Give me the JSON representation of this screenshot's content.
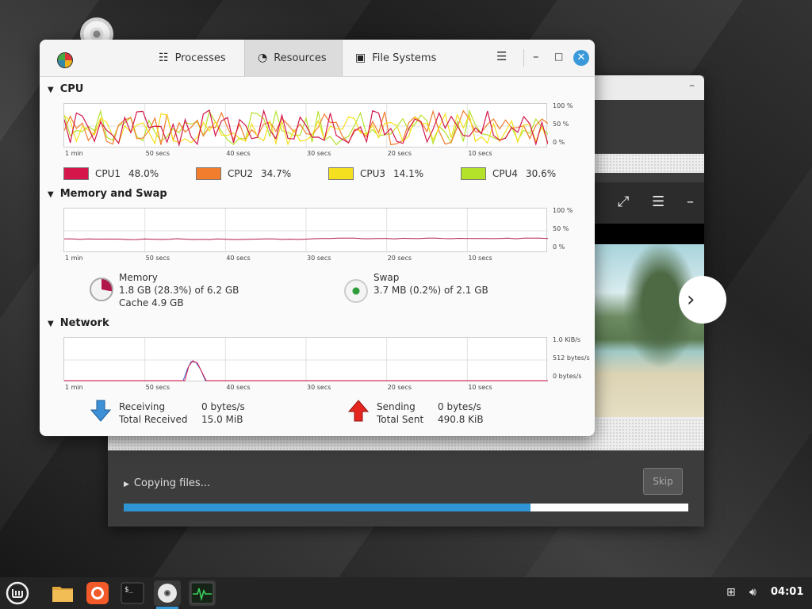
{
  "monitor": {
    "tabs": [
      {
        "label": "Processes",
        "icon": "list-icon"
      },
      {
        "label": "Resources",
        "icon": "gauge-icon"
      },
      {
        "label": "File Systems",
        "icon": "disk-icon"
      }
    ],
    "active_tab": "Resources",
    "cpu": {
      "title": "CPU",
      "legend": [
        {
          "label": "CPU1",
          "value": "48.0%",
          "color": "#d4164b"
        },
        {
          "label": "CPU2",
          "value": "34.7%",
          "color": "#f17d2d"
        },
        {
          "label": "CPU3",
          "value": "14.1%",
          "color": "#f5e020"
        },
        {
          "label": "CPU4",
          "value": "30.6%",
          "color": "#b4e22b"
        }
      ]
    },
    "memory": {
      "title": "Memory and Swap",
      "mem_label": "Memory",
      "mem_value": "1.8 GB (28.3%) of 6.2 GB",
      "mem_cache": "Cache 4.9 GB",
      "swap_label": "Swap",
      "swap_value": "3.7 MB (0.2%) of 2.1 GB"
    },
    "network": {
      "title": "Network",
      "receiving_label": "Receiving",
      "receiving_value": "0 bytes/s",
      "total_received_label": "Total Received",
      "total_received_value": "15.0 MiB",
      "sending_label": "Sending",
      "sending_value": "0 bytes/s",
      "total_sent_label": "Total Sent",
      "total_sent_value": "490.8 KiB"
    },
    "x_ticks": [
      "1 min",
      "50 secs",
      "40 secs",
      "30 secs",
      "20 secs",
      "10 secs"
    ],
    "pct_ticks": [
      "100 %",
      "50 %",
      "0 %"
    ],
    "net_ticks": [
      "1.0 KiB/s",
      "512 bytes/s",
      "0 bytes/s"
    ]
  },
  "installer": {
    "status": "Copying files...",
    "skip_label": "Skip",
    "progress": 0.72
  },
  "taskbar": {
    "apps": [
      "menu-icon",
      "files-icon",
      "firefox-icon",
      "terminal-icon",
      "disc-icon",
      "system-monitor-icon"
    ],
    "clock": "04:01"
  }
}
